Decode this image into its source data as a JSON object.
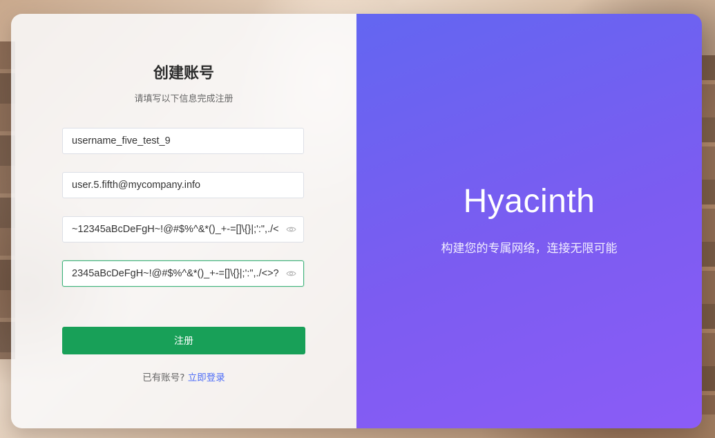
{
  "form": {
    "title": "创建账号",
    "subtitle": "请填写以下信息完成注册",
    "username_value": "username_five_test_9",
    "email_value": "user.5.fifth@mycompany.info",
    "password_value": "~12345aBcDeFgH~!@#$%^&*()_+-=[]\\{}|;':\",./<",
    "confirm_password_value": "2345aBcDeFgH~!@#$%^&*()_+-=[]\\{}|;':\",./<>?",
    "submit_label": "注册",
    "has_account_text": "已有账号?",
    "login_link_label": "立即登录"
  },
  "hero": {
    "brand": "Hyacinth",
    "slogan": "构建您的专属网络，连接无限可能"
  },
  "icons": {
    "password_toggle": "eye-icon",
    "confirm_password_toggle": "eye-icon"
  },
  "colors": {
    "primary_button": "#18a058",
    "link": "#4f6ef7",
    "hero_gradient_start": "#6366f1",
    "hero_gradient_end": "#8b5cf6",
    "focus_border": "#3fb37b"
  }
}
